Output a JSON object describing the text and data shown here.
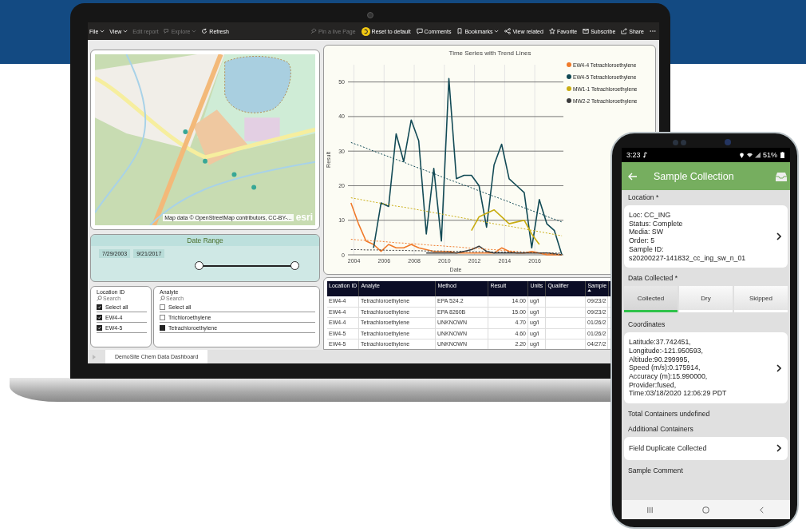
{
  "laptop": {
    "toolbar_left": [
      {
        "kind": "menu",
        "label": "File",
        "disabled": false,
        "dropdown": true
      },
      {
        "kind": "menu",
        "label": "View",
        "disabled": false,
        "dropdown": true
      },
      {
        "kind": "plain",
        "label": "Edit report",
        "disabled": true,
        "dropdown": false
      },
      {
        "kind": "explore",
        "label": "Explore",
        "disabled": true,
        "dropdown": true
      },
      {
        "kind": "refresh",
        "label": "Refresh",
        "disabled": false,
        "dropdown": false
      }
    ],
    "toolbar_right": [
      {
        "kind": "pin",
        "label": "Pin a live Page",
        "disabled": true,
        "dropdown": false
      },
      {
        "kind": "reset",
        "label": "Reset to default",
        "disabled": false,
        "dropdown": false
      },
      {
        "kind": "comment",
        "label": "Comments",
        "disabled": false,
        "dropdown": false
      },
      {
        "kind": "bookmark",
        "label": "Bookmarks",
        "disabled": false,
        "dropdown": true
      },
      {
        "kind": "related",
        "label": "View related",
        "disabled": false,
        "dropdown": false
      },
      {
        "kind": "star",
        "label": "Favorite",
        "disabled": false,
        "dropdown": false
      },
      {
        "kind": "mail",
        "label": "Subscribe",
        "disabled": false,
        "dropdown": false
      },
      {
        "kind": "share",
        "label": "Share",
        "disabled": false,
        "dropdown": false
      },
      {
        "kind": "more",
        "disabled": false,
        "dropdown": false
      }
    ],
    "map": {
      "attribution": "Map data © OpenStreetMap contributors, CC-BY-...",
      "logo": "esri"
    },
    "date_range": {
      "title": "Date Range",
      "start": "7/29/2003",
      "end": "9/21/2017",
      "handles": [
        {
          "level": 0.47
        },
        {
          "level": 0.96
        }
      ]
    },
    "slicers": [
      {
        "title": "Location ID",
        "placeholder": "Search",
        "items": [
          {
            "label": "Select all",
            "checked": true
          },
          {
            "label": "EW4-4",
            "checked": true
          },
          {
            "label": "EW4-5",
            "checked": true
          }
        ]
      },
      {
        "title": "Analyte",
        "placeholder": "Search",
        "items": [
          {
            "label": "Select all",
            "checked": false
          },
          {
            "label": "Trichloroethylene",
            "checked": false
          },
          {
            "label": "Tetrachloroethylene",
            "checked": true
          }
        ]
      }
    ],
    "chart": {
      "chart_data": {
        "type": "line",
        "title": "Time Series with Trend Lines",
        "xlabel": "Date",
        "ylabel": "Result",
        "x": [
          2003.8,
          2004.3,
          2004.8,
          2005.3,
          2005.8,
          2006.3,
          2006.8,
          2007.3,
          2007.8,
          2008.3,
          2008.8,
          2009.3,
          2009.8,
          2010.3,
          2010.8,
          2011.3,
          2011.8,
          2012.3,
          2012.8,
          2013.3,
          2013.8,
          2014.3,
          2014.8,
          2015.3,
          2015.8,
          2016.3,
          2016.8,
          2017.3,
          2017.8
        ],
        "series": [
          {
            "name": "EW4-4 Tetrachloroethylene",
            "color": "#f07a2a",
            "values": [
              15,
              9,
              4,
              3,
              1,
              3,
              2,
              2,
              3,
              2,
              1.5,
              1,
              1,
              1,
              0.5,
              0.5,
              0.5,
              0.5,
              0.5,
              0.5,
              2,
              1,
              0.5,
              0.5,
              1,
              0.5,
              0,
              0,
              0
            ]
          },
          {
            "name": "EW4-5 Tetrachloroethylene",
            "color": "#124a55",
            "values": [
              null,
              null,
              null,
              2,
              15,
              14,
              35,
              27,
              39,
              33,
              6,
              25,
              4,
              51,
              22,
              23,
              23,
              20,
              8,
              26,
              32,
              22,
              20,
              18,
              2,
              16,
              9,
              7,
              0
            ]
          },
          {
            "name": "MW1-1 Tetrachloroethylene",
            "color": "#c9ad12",
            "values": [
              null,
              null,
              null,
              null,
              null,
              null,
              null,
              null,
              null,
              null,
              null,
              null,
              null,
              null,
              null,
              null,
              7,
              11,
              12,
              13,
              11,
              9,
              9.5,
              10,
              6,
              3,
              null,
              null,
              null
            ]
          },
          {
            "name": "MW2-2 Tetrachloroethylene",
            "color": "#3c3c3c",
            "values": [
              null,
              null,
              null,
              null,
              null,
              null,
              null,
              null,
              null,
              null,
              0.5,
              0.5,
              0.5,
              0.5,
              0.5,
              1,
              1.5,
              2.5,
              1,
              0.5,
              0.5,
              0.5,
              0.5,
              0.5,
              0.5,
              0.5,
              0.5,
              0.3,
              0
            ]
          },
          {
            "color": "#124a55",
            "line_style": "dotted",
            "values": [
              32.5,
              31.7,
              30.9,
              30,
              29.2,
              28.4,
              27.6,
              26.8,
              25.9,
              25.1,
              24.3,
              23.5,
              22.6,
              21.8,
              21,
              20.2,
              19.4,
              18.5,
              17.7,
              16.9,
              16.1,
              15.3,
              14.4,
              13.6,
              12.8,
              12,
              11.1,
              10.3,
              9.5
            ]
          },
          {
            "color": "#c9ad12",
            "line_style": "dotted",
            "values": [
              16.5,
              16.1,
              15.7,
              15.3,
              14.9,
              14.5,
              14.1,
              13.8,
              13.4,
              13,
              12.6,
              12.2,
              11.8,
              11.4,
              11,
              10.6,
              10.2,
              9.8,
              9.4,
              9,
              8.6,
              8.3,
              7.9,
              7.5,
              7.1,
              6.7,
              6.3,
              5.9,
              5.5
            ]
          },
          {
            "color": "#f07a2a",
            "line_style": "dotted",
            "values": [
              4.5,
              4.3,
              4.2,
              4,
              3.9,
              3.7,
              3.5,
              3.4,
              3.2,
              3.1,
              2.9,
              2.7,
              2.6,
              2.4,
              2.3,
              2.1,
              1.9,
              1.8,
              1.6,
              1.5,
              1.3,
              1.1,
              1,
              0.8,
              0.6,
              0.5,
              0.3,
              0.2,
              0
            ]
          },
          {
            "color": "#3c3c3c",
            "line_style": "dotted",
            "values": [
              1.5,
              1.5,
              1.4,
              1.4,
              1.4,
              1.3,
              1.3,
              1.3,
              1.2,
              1.2,
              1.1,
              1.1,
              1.1,
              1,
              1,
              1,
              0.9,
              0.9,
              0.9,
              0.8,
              0.8,
              0.8,
              0.7,
              0.7,
              0.6,
              0.6,
              0.6,
              0.5,
              0.5
            ]
          }
        ],
        "xlim": [
          2003.6,
          2017.9
        ],
        "ylim": [
          0,
          55
        ],
        "xticks": [
          2004,
          2006,
          2008,
          2010,
          2012,
          2014,
          2016
        ],
        "yticks": [
          0,
          10,
          20,
          30,
          40,
          50
        ],
        "grid": true,
        "legend": "right"
      }
    },
    "table": {
      "columns": [
        {
          "label": "Location ID",
          "sorted": false
        },
        {
          "label": "Analyte",
          "sorted": false
        },
        {
          "label": "Method",
          "sorted": false
        },
        {
          "label": "Result",
          "sorted": false
        },
        {
          "label": "Units",
          "sorted": false
        },
        {
          "label": "Qualifier",
          "sorted": false
        },
        {
          "label": "Sample",
          "sorted": true
        }
      ],
      "rows": [
        [
          "EW4-4",
          "Tetrachloroethylene",
          "EPA 524.2",
          "14.00",
          "ug/l",
          "",
          "09/23/2"
        ],
        [
          "EW4-4",
          "Tetrachloroethylene",
          "EPA 8260B",
          "15.00",
          "ug/l",
          "",
          "09/23/2"
        ],
        [
          "EW4-4",
          "Tetrachloroethylene",
          "UNKNOWN",
          "4.70",
          "ug/l",
          "",
          "01/26/2"
        ],
        [
          "EW4-5",
          "Tetrachloroethylene",
          "UNKNOWN",
          "4.60",
          "ug/l",
          "",
          "01/26/2"
        ],
        [
          "EW4-5",
          "Tetrachloroethylene",
          "UNKNOWN",
          "2.20",
          "ug/l",
          "",
          "04/27/2"
        ]
      ]
    },
    "tabs": [
      {
        "label": "DemoSite Chem Data Dashboard",
        "selected": true
      }
    ]
  },
  "phone": {
    "status_bar": {
      "time": "3:23",
      "battery": "51%"
    },
    "header": {
      "title": "Sample Collection"
    },
    "sections": [
      {
        "kind": "label",
        "text": "Location *"
      },
      {
        "kind": "card",
        "lines": [
          "Loc: CC_ING",
          "Status: Complete",
          "Media: SW",
          "Order: 5",
          "Sample ID:",
          "s20200227-141832_cc_ing_sw_n_01"
        ]
      },
      {
        "kind": "label",
        "text": "Data Collected *"
      },
      {
        "kind": "segmented",
        "options": [
          {
            "label": "Collected",
            "selected": true
          },
          {
            "label": "Dry",
            "selected": false
          },
          {
            "label": "Skipped",
            "selected": false
          }
        ]
      },
      {
        "kind": "label",
        "text": "Coordinates"
      },
      {
        "kind": "card",
        "lines": [
          "Latitude:37.742451,",
          "Longitude:-121.950593,",
          "Altitude:90.299995,",
          "Speed (m/s):0.175914,",
          "Accuracy (m):15.990000,",
          "Provider:fused,",
          "Time:03/18/2020 12:06:29 PDT"
        ]
      },
      {
        "kind": "label",
        "text": "Total Containers undefined"
      },
      {
        "kind": "label",
        "text": "Additional Containers"
      },
      {
        "kind": "card",
        "lines": [
          "Field Duplicate Collected"
        ]
      },
      {
        "kind": "label",
        "text": "Sample Comment"
      }
    ]
  }
}
